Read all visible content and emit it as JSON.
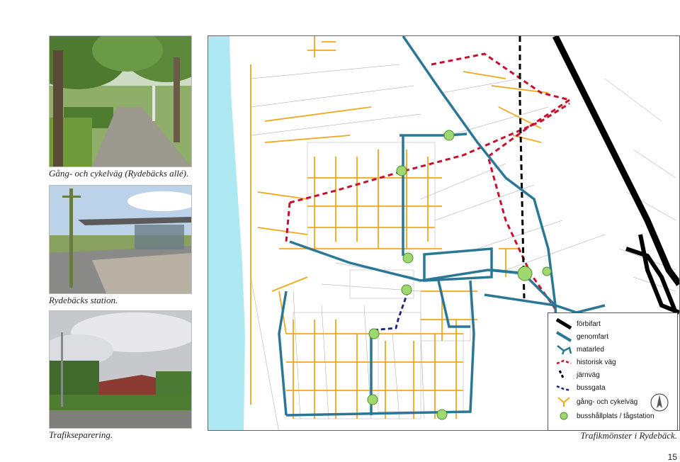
{
  "photos": [
    {
      "caption": "Gång- och cykelväg (Rydebäcks allé)."
    },
    {
      "caption": "Rydebäcks station."
    },
    {
      "caption": "Trafikseparering."
    }
  ],
  "map": {
    "caption": "Trafikmönster i Rydebäck.",
    "colors": {
      "sea": "#aee9f3",
      "genomfart": "#2b7796",
      "historisk": "#c8102e",
      "gang_cykel": "#f0a81c",
      "bussgata": "#1a237e",
      "busstop": "#9ed86e",
      "forbifart": "#000000"
    },
    "legend": [
      {
        "key": "forbifart",
        "label": "förbifart",
        "icon": "black-thick-line-icon"
      },
      {
        "key": "genomfart",
        "label": "genomfart",
        "icon": "teal-thick-line-icon"
      },
      {
        "key": "matarled",
        "label": "matarled",
        "icon": "teal-loop-icon"
      },
      {
        "key": "historisk",
        "label": "historisk väg",
        "icon": "red-dashed-line-icon"
      },
      {
        "key": "jarnvag",
        "label": "järnväg",
        "icon": "railway-dashed-icon"
      },
      {
        "key": "bussgata",
        "label": "bussgata",
        "icon": "blue-dashed-line-icon"
      },
      {
        "key": "gang_cykel",
        "label": "gång- och cykelväg",
        "icon": "orange-fork-icon"
      },
      {
        "key": "busshallplats",
        "label": "busshållplats / tågstation",
        "icon": "green-dot-icon"
      }
    ],
    "compass_icon": "north-arrow-icon"
  },
  "page_number": "15"
}
